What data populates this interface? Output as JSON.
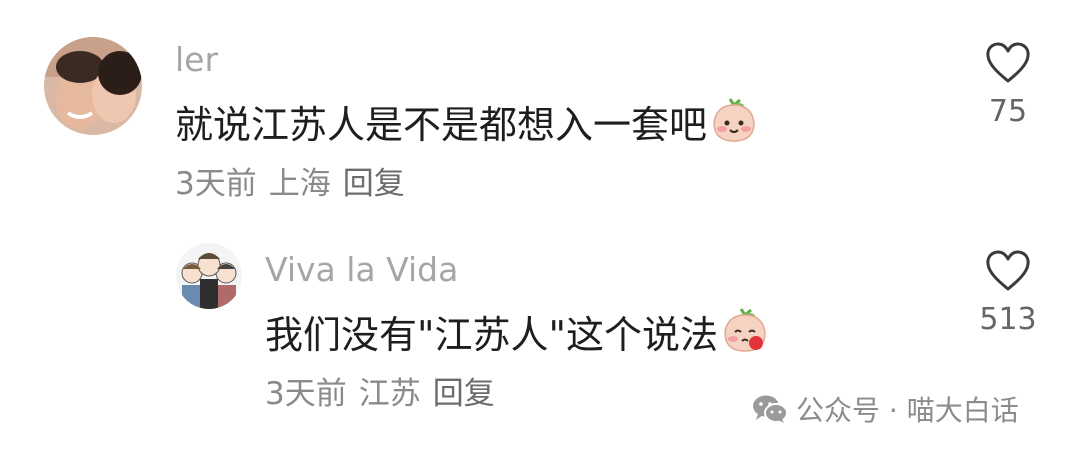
{
  "comments": [
    {
      "username": "ler",
      "text": "就说江苏人是不是都想入一套吧",
      "time": "3天前",
      "location": "上海",
      "reply_label": "回复",
      "likes": "75",
      "avatar_icon": "couple-photo-avatar",
      "emoji_icon": "peach-smile-emoji"
    },
    {
      "username": "Viva la Vida",
      "text": "我们没有\"江苏人\"这个说法",
      "time": "3天前",
      "location": "江苏",
      "reply_label": "回复",
      "likes": "513",
      "avatar_icon": "cartoon-group-avatar",
      "emoji_icon": "peach-blush-emoji"
    }
  ],
  "watermark": {
    "text": "公众号 · 喵大白话",
    "icon": "wechat-icon"
  },
  "colors": {
    "username": "#a6a6a6",
    "text": "#1e1e1e",
    "meta": "#8a8a8a",
    "heart_stroke": "#3a3a3a"
  }
}
